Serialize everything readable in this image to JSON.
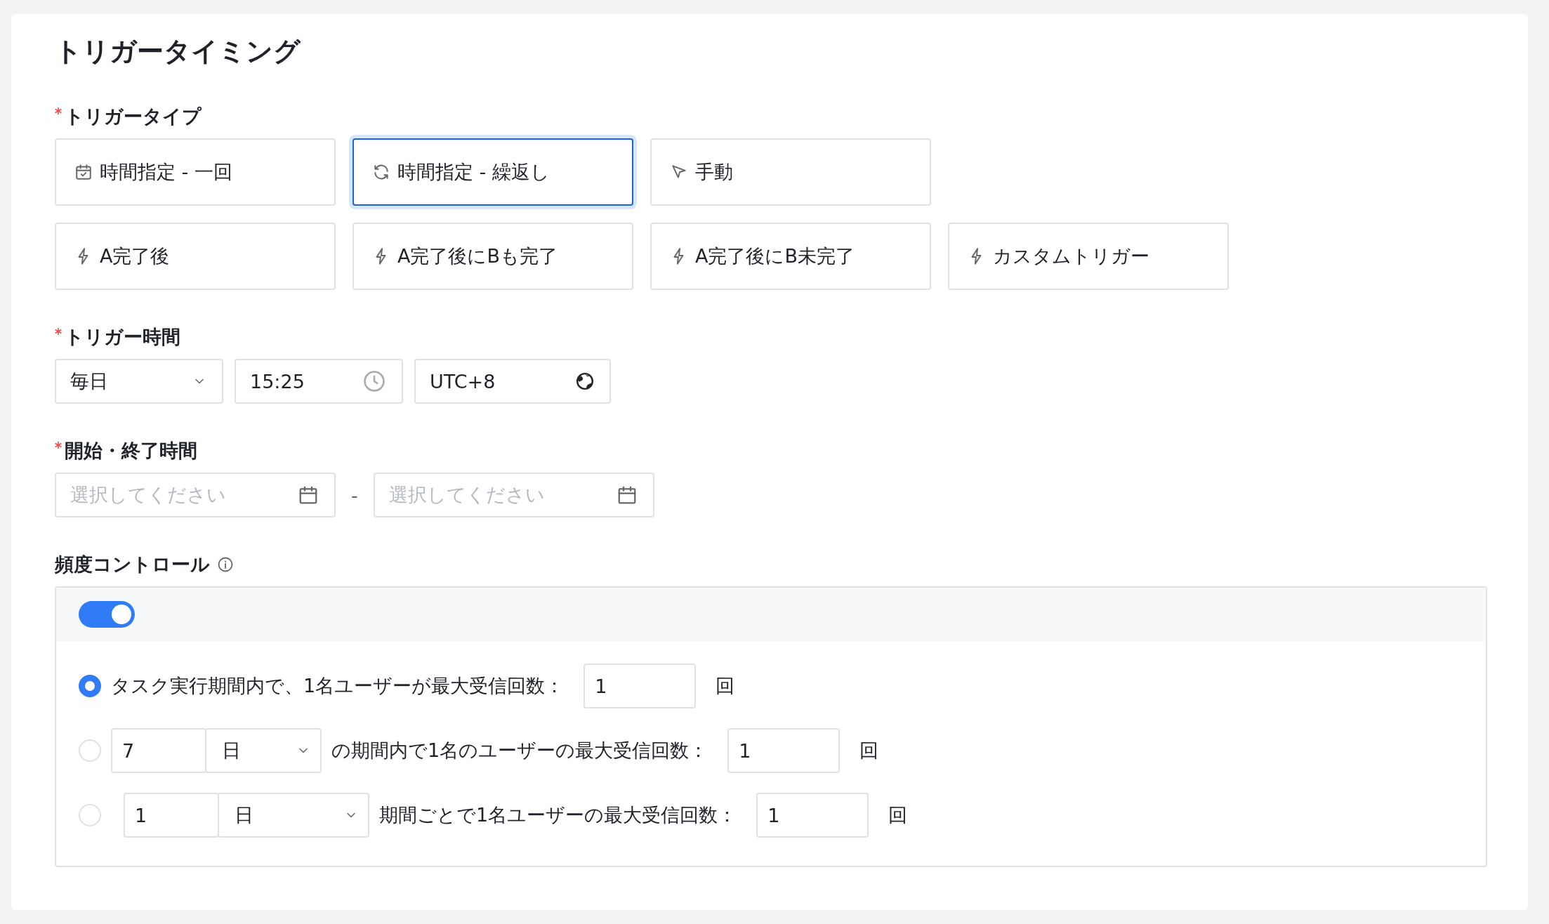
{
  "title": "トリガータイミング",
  "trigger_type": {
    "label": "トリガータイプ",
    "required": true,
    "options": [
      {
        "kind": "calendar",
        "label": "時間指定 - 一回",
        "selected": false
      },
      {
        "kind": "refresh",
        "label": "時間指定 - 繰返し",
        "selected": true
      },
      {
        "kind": "cursor",
        "label": "手動",
        "selected": false
      },
      {
        "kind": "bolt",
        "label": "A完了後",
        "selected": false
      },
      {
        "kind": "bolt",
        "label": "A完了後にBも完了",
        "selected": false
      },
      {
        "kind": "bolt",
        "label": "A完了後にB未完了",
        "selected": false
      },
      {
        "kind": "bolt",
        "label": "カスタムトリガー",
        "selected": false
      }
    ]
  },
  "trigger_time": {
    "label": "トリガー時間",
    "required": true,
    "frequency": "毎日",
    "time": "15:25",
    "timezone": "UTC+8"
  },
  "period": {
    "label": "開始・終了時間",
    "required": true,
    "start_placeholder": "選択してください",
    "separator": "-",
    "end_placeholder": "選択してください"
  },
  "frequency_control": {
    "label": "頻度コントロール",
    "on": true,
    "rules": [
      {
        "kind": "total",
        "selected": true,
        "text": "タスク実行期間内で、1名ユーザーが最大受信回数：",
        "value": "1",
        "unit": "回"
      },
      {
        "kind": "window",
        "selected": false,
        "period_value": "7",
        "period_unit": "日",
        "text": "の期間内で1名のユーザーの最大受信回数：",
        "value": "1",
        "unit": "回"
      },
      {
        "kind": "each",
        "selected": false,
        "period_value": "1",
        "period_unit": "日",
        "text": "期間ごとで1名ユーザーの最大受信回数：",
        "value": "1",
        "unit": "回"
      }
    ]
  }
}
